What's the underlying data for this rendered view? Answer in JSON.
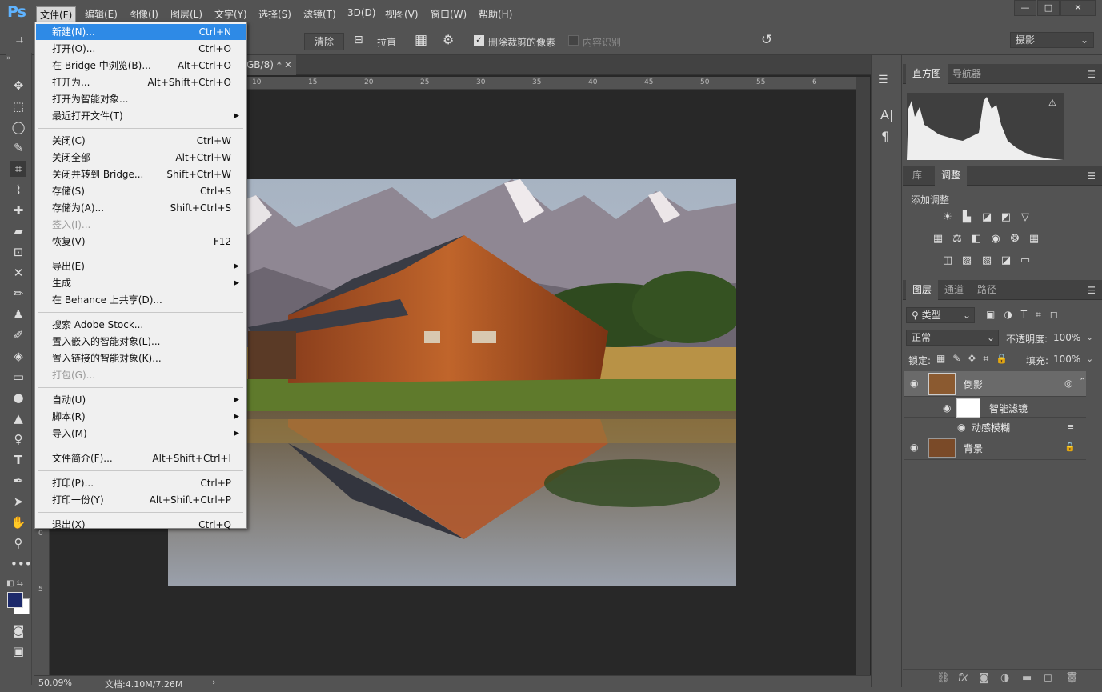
{
  "app": {
    "logo": "Ps"
  },
  "menubar": [
    {
      "label": "文件(F)",
      "active": true
    },
    {
      "label": "编辑(E)"
    },
    {
      "label": "图像(I)"
    },
    {
      "label": "图层(L)"
    },
    {
      "label": "文字(Y)"
    },
    {
      "label": "选择(S)"
    },
    {
      "label": "滤镜(T)"
    },
    {
      "label": "3D(D)"
    },
    {
      "label": "视图(V)"
    },
    {
      "label": "窗口(W)"
    },
    {
      "label": "帮助(H)"
    }
  ],
  "window_controls": {
    "minimize": "—",
    "maximize": "□",
    "close": "✕"
  },
  "options_bar": {
    "clear_button": "清除",
    "straighten": "拉直",
    "delete_cropped_label": "删除裁剪的像素",
    "delete_cropped_checked": true,
    "content_aware_label": "内容识别",
    "content_aware_checked": false,
    "workspace": "摄影"
  },
  "document": {
    "tab_title": "GB/8) *",
    "tab_close": "✕",
    "zoom": "50.09%",
    "doc_size": "文档:4.10M/7.26M",
    "ruler_h_ticks": [
      "10",
      "15",
      "20",
      "25",
      "30",
      "35",
      "40",
      "45",
      "50",
      "55",
      "6"
    ],
    "ruler_v_ticks": [
      "0",
      "5"
    ]
  },
  "file_menu": {
    "items": [
      {
        "label": "新建(N)...",
        "shortcut": "Ctrl+N",
        "selected": true
      },
      {
        "label": "打开(O)...",
        "shortcut": "Ctrl+O"
      },
      {
        "label": "在 Bridge 中浏览(B)...",
        "shortcut": "Alt+Ctrl+O"
      },
      {
        "label": "打开为...",
        "shortcut": "Alt+Shift+Ctrl+O"
      },
      {
        "label": "打开为智能对象..."
      },
      {
        "label": "最近打开文件(T)",
        "submenu": true
      },
      {
        "sep": true
      },
      {
        "label": "关闭(C)",
        "shortcut": "Ctrl+W"
      },
      {
        "label": "关闭全部",
        "shortcut": "Alt+Ctrl+W"
      },
      {
        "label": "关闭并转到 Bridge...",
        "shortcut": "Shift+Ctrl+W"
      },
      {
        "label": "存储(S)",
        "shortcut": "Ctrl+S"
      },
      {
        "label": "存储为(A)...",
        "shortcut": "Shift+Ctrl+S"
      },
      {
        "label": "签入(I)...",
        "disabled": true
      },
      {
        "label": "恢复(V)",
        "shortcut": "F12"
      },
      {
        "sep": true
      },
      {
        "label": "导出(E)",
        "submenu": true
      },
      {
        "label": "生成",
        "submenu": true
      },
      {
        "label": "在 Behance 上共享(D)..."
      },
      {
        "sep": true
      },
      {
        "label": "搜索 Adobe Stock..."
      },
      {
        "label": "置入嵌入的智能对象(L)..."
      },
      {
        "label": "置入链接的智能对象(K)..."
      },
      {
        "label": "打包(G)...",
        "disabled": true
      },
      {
        "sep": true
      },
      {
        "label": "自动(U)",
        "submenu": true
      },
      {
        "label": "脚本(R)",
        "submenu": true
      },
      {
        "label": "导入(M)",
        "submenu": true
      },
      {
        "sep": true
      },
      {
        "label": "文件简介(F)...",
        "shortcut": "Alt+Shift+Ctrl+I"
      },
      {
        "sep": true
      },
      {
        "label": "打印(P)...",
        "shortcut": "Ctrl+P"
      },
      {
        "label": "打印一份(Y)",
        "shortcut": "Alt+Shift+Ctrl+P"
      },
      {
        "sep": true
      },
      {
        "label": "退出(X)",
        "shortcut": "Ctrl+Q"
      }
    ]
  },
  "panels": {
    "histogram_tabs": [
      "直方图",
      "导航器"
    ],
    "adjust_tabs": [
      "库",
      "调整"
    ],
    "adjust_title": "添加调整",
    "layers_tabs": [
      "图层",
      "通道",
      "路径"
    ],
    "layer_filter": "类型",
    "blend_mode": "正常",
    "opacity_label": "不透明度:",
    "opacity_value": "100%",
    "lock_label": "锁定:",
    "fill_label": "填充:",
    "fill_value": "100%",
    "layers": [
      {
        "name": "倒影",
        "kind": "smart"
      },
      {
        "name": "智能滤镜",
        "kind": "filter-mask"
      },
      {
        "name": "动感模糊",
        "kind": "filter"
      },
      {
        "name": "背景",
        "kind": "background"
      }
    ],
    "side_icons": [
      "A|",
      "¶"
    ]
  },
  "colors": {
    "ui_bg": "#535353",
    "canvas_bg": "#282828",
    "menu_highlight": "#2e8ae6",
    "logo": "#5fb3ff"
  }
}
